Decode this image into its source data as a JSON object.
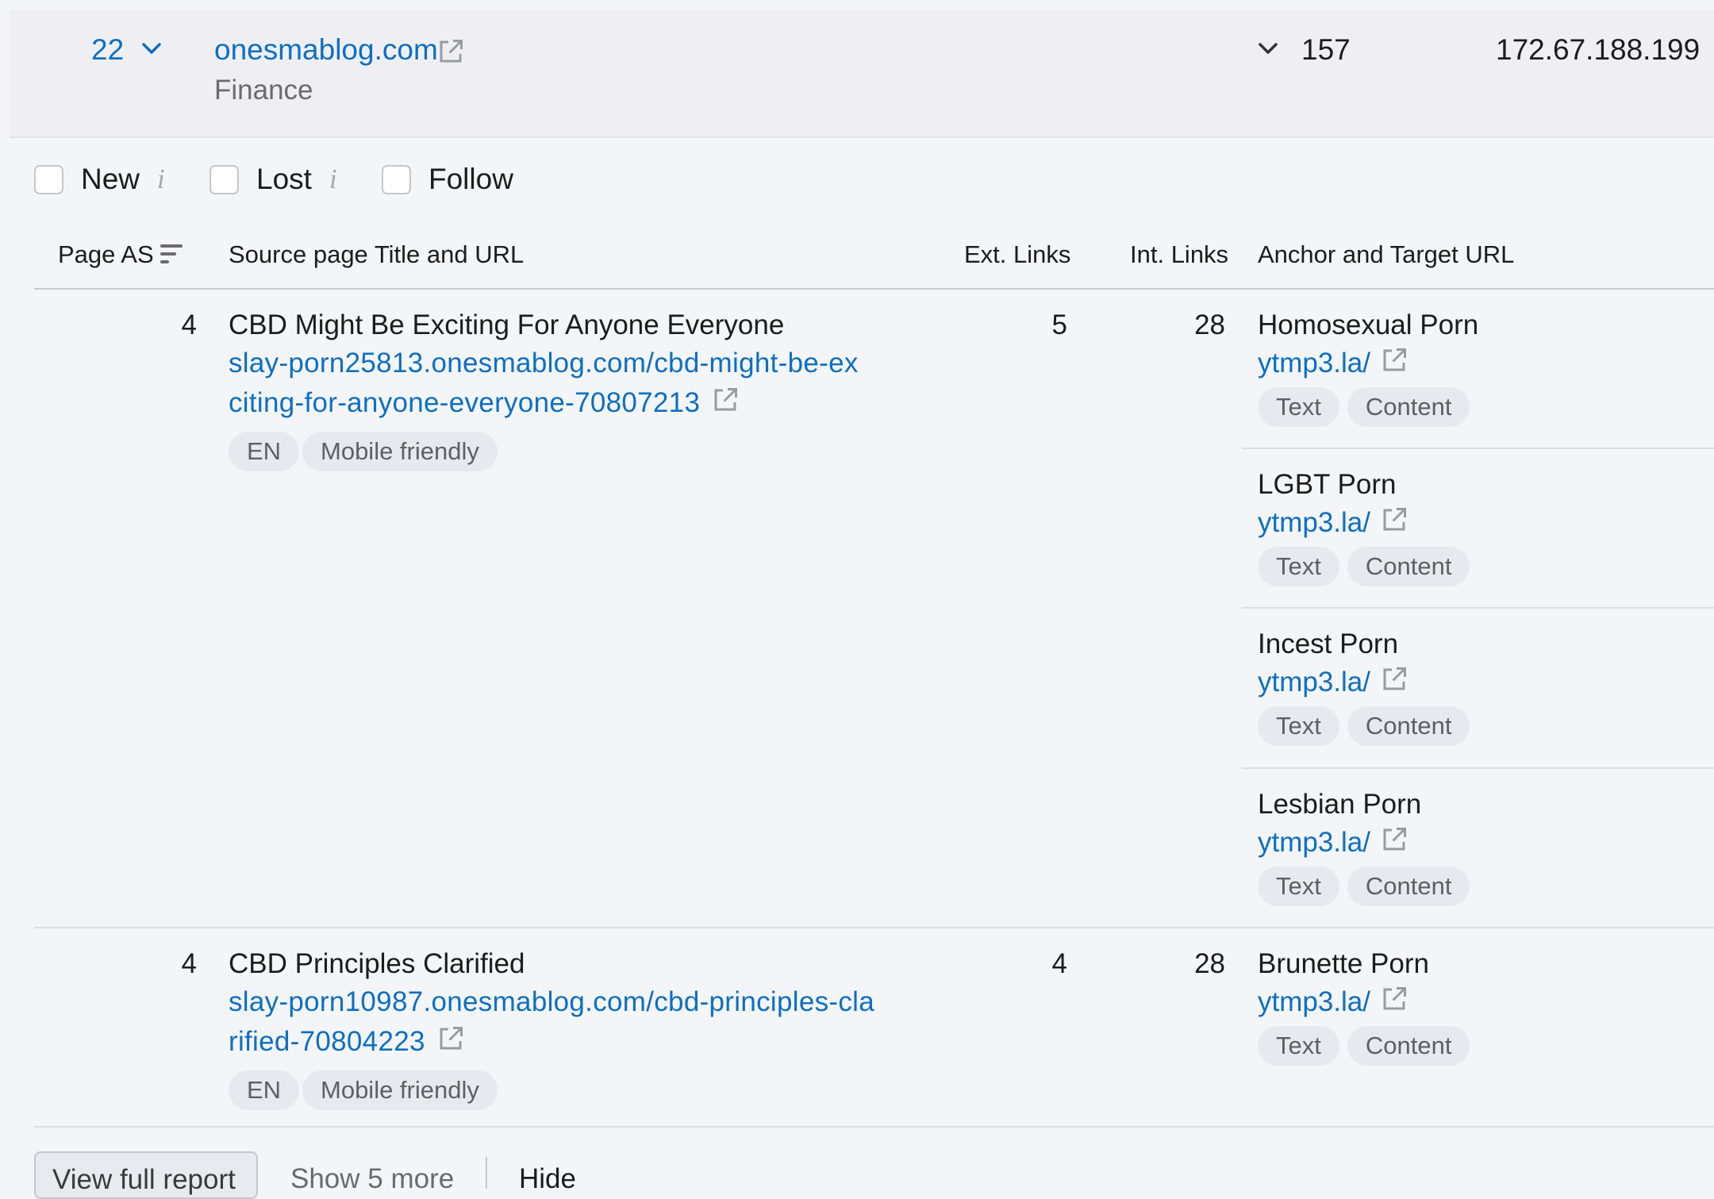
{
  "domain_row": {
    "rank": "22",
    "domain": "onesmablog.com",
    "category": "Finance",
    "count": "157",
    "ip": "172.67.188.199"
  },
  "filters": {
    "new_label": "New",
    "lost_label": "Lost",
    "follow_label": "Follow",
    "info_glyph": "i"
  },
  "table": {
    "headers": {
      "page_as": "Page AS",
      "source": "Source page Title and URL",
      "ext_links": "Ext. Links",
      "int_links": "Int. Links",
      "anchor": "Anchor and Target URL"
    },
    "rows": [
      {
        "page_as": "4",
        "title": "CBD Might Be Exciting For Anyone Everyone",
        "url_line1": "slay-porn25813.onesmablog.com/cbd-might-be-ex",
        "url_line2": "citing-for-anyone-everyone-70807213",
        "lang": "EN",
        "mobile": "Mobile friendly",
        "ext_links": "5",
        "int_links": "28",
        "anchors": [
          {
            "text": "Homosexual Porn",
            "url": "ytmp3.la/",
            "type": "Text",
            "position": "Content"
          },
          {
            "text": "LGBT Porn",
            "url": "ytmp3.la/",
            "type": "Text",
            "position": "Content"
          },
          {
            "text": "Incest Porn",
            "url": "ytmp3.la/",
            "type": "Text",
            "position": "Content"
          },
          {
            "text": "Lesbian Porn",
            "url": "ytmp3.la/",
            "type": "Text",
            "position": "Content"
          }
        ]
      },
      {
        "page_as": "4",
        "title": "CBD Principles Clarified",
        "url_line1": "slay-porn10987.onesmablog.com/cbd-principles-cla",
        "url_line2": "rified-70804223",
        "lang": "EN",
        "mobile": "Mobile friendly",
        "ext_links": "4",
        "int_links": "28",
        "anchors": [
          {
            "text": "Brunette Porn",
            "url": "ytmp3.la/",
            "type": "Text",
            "position": "Content"
          }
        ]
      }
    ]
  },
  "footer": {
    "view_full_report": "View full report",
    "show_more": "Show 5 more",
    "hide": "Hide"
  },
  "colors": {
    "link": "#0d6fc2",
    "background": "#f4f5f9",
    "chip_bg": "#e8e9ee"
  },
  "icons": [
    "chevron-down-icon",
    "external-link-icon",
    "info-icon",
    "sort-icon"
  ]
}
